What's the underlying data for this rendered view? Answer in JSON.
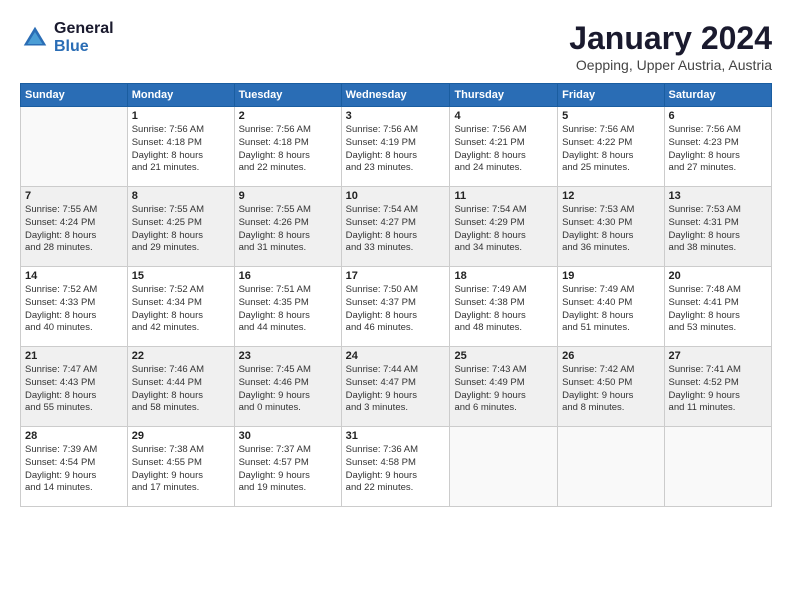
{
  "logo": {
    "line1": "General",
    "line2": "Blue"
  },
  "title": "January 2024",
  "location": "Oepping, Upper Austria, Austria",
  "weekdays": [
    "Sunday",
    "Monday",
    "Tuesday",
    "Wednesday",
    "Thursday",
    "Friday",
    "Saturday"
  ],
  "weeks": [
    [
      {
        "day": "",
        "info": ""
      },
      {
        "day": "1",
        "info": "Sunrise: 7:56 AM\nSunset: 4:18 PM\nDaylight: 8 hours\nand 21 minutes."
      },
      {
        "day": "2",
        "info": "Sunrise: 7:56 AM\nSunset: 4:18 PM\nDaylight: 8 hours\nand 22 minutes."
      },
      {
        "day": "3",
        "info": "Sunrise: 7:56 AM\nSunset: 4:19 PM\nDaylight: 8 hours\nand 23 minutes."
      },
      {
        "day": "4",
        "info": "Sunrise: 7:56 AM\nSunset: 4:21 PM\nDaylight: 8 hours\nand 24 minutes."
      },
      {
        "day": "5",
        "info": "Sunrise: 7:56 AM\nSunset: 4:22 PM\nDaylight: 8 hours\nand 25 minutes."
      },
      {
        "day": "6",
        "info": "Sunrise: 7:56 AM\nSunset: 4:23 PM\nDaylight: 8 hours\nand 27 minutes."
      }
    ],
    [
      {
        "day": "7",
        "info": "Sunrise: 7:55 AM\nSunset: 4:24 PM\nDaylight: 8 hours\nand 28 minutes."
      },
      {
        "day": "8",
        "info": "Sunrise: 7:55 AM\nSunset: 4:25 PM\nDaylight: 8 hours\nand 29 minutes."
      },
      {
        "day": "9",
        "info": "Sunrise: 7:55 AM\nSunset: 4:26 PM\nDaylight: 8 hours\nand 31 minutes."
      },
      {
        "day": "10",
        "info": "Sunrise: 7:54 AM\nSunset: 4:27 PM\nDaylight: 8 hours\nand 33 minutes."
      },
      {
        "day": "11",
        "info": "Sunrise: 7:54 AM\nSunset: 4:29 PM\nDaylight: 8 hours\nand 34 minutes."
      },
      {
        "day": "12",
        "info": "Sunrise: 7:53 AM\nSunset: 4:30 PM\nDaylight: 8 hours\nand 36 minutes."
      },
      {
        "day": "13",
        "info": "Sunrise: 7:53 AM\nSunset: 4:31 PM\nDaylight: 8 hours\nand 38 minutes."
      }
    ],
    [
      {
        "day": "14",
        "info": "Sunrise: 7:52 AM\nSunset: 4:33 PM\nDaylight: 8 hours\nand 40 minutes."
      },
      {
        "day": "15",
        "info": "Sunrise: 7:52 AM\nSunset: 4:34 PM\nDaylight: 8 hours\nand 42 minutes."
      },
      {
        "day": "16",
        "info": "Sunrise: 7:51 AM\nSunset: 4:35 PM\nDaylight: 8 hours\nand 44 minutes."
      },
      {
        "day": "17",
        "info": "Sunrise: 7:50 AM\nSunset: 4:37 PM\nDaylight: 8 hours\nand 46 minutes."
      },
      {
        "day": "18",
        "info": "Sunrise: 7:49 AM\nSunset: 4:38 PM\nDaylight: 8 hours\nand 48 minutes."
      },
      {
        "day": "19",
        "info": "Sunrise: 7:49 AM\nSunset: 4:40 PM\nDaylight: 8 hours\nand 51 minutes."
      },
      {
        "day": "20",
        "info": "Sunrise: 7:48 AM\nSunset: 4:41 PM\nDaylight: 8 hours\nand 53 minutes."
      }
    ],
    [
      {
        "day": "21",
        "info": "Sunrise: 7:47 AM\nSunset: 4:43 PM\nDaylight: 8 hours\nand 55 minutes."
      },
      {
        "day": "22",
        "info": "Sunrise: 7:46 AM\nSunset: 4:44 PM\nDaylight: 8 hours\nand 58 minutes."
      },
      {
        "day": "23",
        "info": "Sunrise: 7:45 AM\nSunset: 4:46 PM\nDaylight: 9 hours\nand 0 minutes."
      },
      {
        "day": "24",
        "info": "Sunrise: 7:44 AM\nSunset: 4:47 PM\nDaylight: 9 hours\nand 3 minutes."
      },
      {
        "day": "25",
        "info": "Sunrise: 7:43 AM\nSunset: 4:49 PM\nDaylight: 9 hours\nand 6 minutes."
      },
      {
        "day": "26",
        "info": "Sunrise: 7:42 AM\nSunset: 4:50 PM\nDaylight: 9 hours\nand 8 minutes."
      },
      {
        "day": "27",
        "info": "Sunrise: 7:41 AM\nSunset: 4:52 PM\nDaylight: 9 hours\nand 11 minutes."
      }
    ],
    [
      {
        "day": "28",
        "info": "Sunrise: 7:39 AM\nSunset: 4:54 PM\nDaylight: 9 hours\nand 14 minutes."
      },
      {
        "day": "29",
        "info": "Sunrise: 7:38 AM\nSunset: 4:55 PM\nDaylight: 9 hours\nand 17 minutes."
      },
      {
        "day": "30",
        "info": "Sunrise: 7:37 AM\nSunset: 4:57 PM\nDaylight: 9 hours\nand 19 minutes."
      },
      {
        "day": "31",
        "info": "Sunrise: 7:36 AM\nSunset: 4:58 PM\nDaylight: 9 hours\nand 22 minutes."
      },
      {
        "day": "",
        "info": ""
      },
      {
        "day": "",
        "info": ""
      },
      {
        "day": "",
        "info": ""
      }
    ]
  ]
}
